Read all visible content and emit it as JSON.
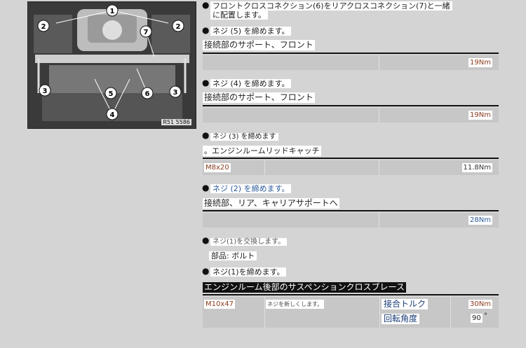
{
  "figure": {
    "id_label": "R51 5586",
    "callouts": [
      "1",
      "2",
      "2",
      "3",
      "3",
      "4",
      "5",
      "6",
      "7"
    ]
  },
  "steps": [
    {
      "text": "フロントクロスコネクション(6)をリアクロスコネクション(7)と一緒",
      "text2": "に配置します。"
    },
    {
      "text": "ネジ (5) を締めます。",
      "section": "接続部のサポート、フロント",
      "torque": "19Nm"
    },
    {
      "text": "ネジ (4) を締めます。",
      "section": "接続部のサポート、フロント",
      "torque": "19Nm"
    },
    {
      "text": "ネジ (3) を締めます",
      "section": "。エンジンルームリッドキャッチ",
      "bolt": "M8x20",
      "torque": "11.8Nm"
    },
    {
      "text": "ネジ (2) を締めます。",
      "section": "接続部、リア、キャリアサポートへ",
      "torque": "28Nm"
    },
    {
      "text": "ネジ(1)を交換します。",
      "note": "部品: ボルト"
    },
    {
      "text": "ネジ(1)を締めます。",
      "section": "エンジンルーム後部のサスペンションクロスブレース",
      "bolt": "M10x47",
      "remark": "ネジを新しくします。",
      "torque_label": "接合トルク",
      "torque": "30Nm",
      "angle_label": "回転角度",
      "angle": "90",
      "angle_unit": "°"
    }
  ]
}
